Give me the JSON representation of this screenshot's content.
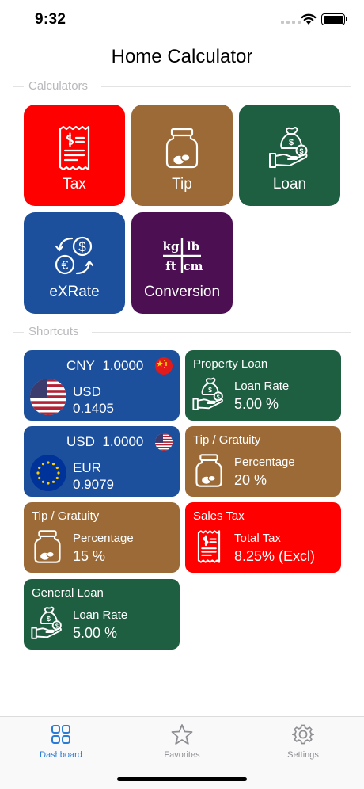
{
  "status": {
    "time": "9:32"
  },
  "nav": {
    "title": "Home Calculator"
  },
  "sections": {
    "calculators": "Calculators",
    "shortcuts": "Shortcuts"
  },
  "colors": {
    "red": "#ff0000",
    "brown": "#9b6a36",
    "green": "#1e5e41",
    "blue": "#1c4f9c",
    "purple": "#4b0f52",
    "accent": "#2a7bd6"
  },
  "calculators": [
    {
      "label": "Tax",
      "icon": "receipt-icon"
    },
    {
      "label": "Tip",
      "icon": "tip-jar-icon"
    },
    {
      "label": "Loan",
      "icon": "loan-money-bag-icon"
    },
    {
      "label": "eXRate",
      "icon": "currency-exchange-icon"
    },
    {
      "label": "Conversion",
      "icon": "unit-conversion-icon",
      "units": {
        "kg": "kg",
        "lb": "lb",
        "ft": "ft",
        "cm": "cm"
      }
    }
  ],
  "shortcuts": {
    "fx1": {
      "base_code": "CNY",
      "base_amount": "1.0000",
      "target_code": "USD",
      "target_value": "0.1405"
    },
    "fx2": {
      "base_code": "USD",
      "base_amount": "1.0000",
      "target_code": "EUR",
      "target_value": "0.9079"
    },
    "property_loan": {
      "title": "Property Loan",
      "key": "Loan Rate",
      "value": "5.00 %"
    },
    "tip_20": {
      "title": "Tip / Gratuity",
      "key": "Percentage",
      "value": "20 %"
    },
    "tip_15": {
      "title": "Tip / Gratuity",
      "key": "Percentage",
      "value": "15 %"
    },
    "sales_tax": {
      "title": "Sales Tax",
      "key": "Total Tax",
      "value": "8.25% (Excl)"
    },
    "general_loan": {
      "title": "General Loan",
      "key": "Loan Rate",
      "value": "5.00 %"
    }
  },
  "tabs": [
    {
      "label": "Dashboard",
      "icon": "grid-icon",
      "active": true
    },
    {
      "label": "Favorites",
      "icon": "star-icon",
      "active": false
    },
    {
      "label": "Settings",
      "icon": "gear-icon",
      "active": false
    }
  ]
}
